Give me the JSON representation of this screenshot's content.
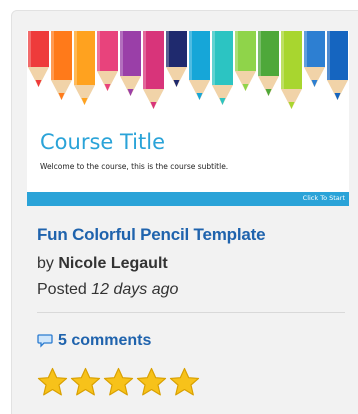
{
  "thumbnail": {
    "course_title": "Course Title",
    "course_subtitle": "Welcome to the course, this is the course subtitle.",
    "start_label": "Click To Start",
    "pencil_colors": [
      "#ee3b3b",
      "#ff7a1a",
      "#ffa21f",
      "#e8437c",
      "#9a3fa8",
      "#d8347a",
      "#1f2a6e",
      "#16a6d8",
      "#2cc4c2",
      "#8fd44a",
      "#4ea83a",
      "#a8d62f",
      "#2d7fd2",
      "#1565c0"
    ]
  },
  "template": {
    "title": "Fun Colorful Pencil Template",
    "by_prefix": "by",
    "author": "Nicole Legault",
    "posted_prefix": "Posted",
    "posted_time": "12 days ago"
  },
  "comments": {
    "icon": "speech-bubble-icon",
    "label": "5 comments"
  },
  "rating": {
    "value": 5,
    "max": 5,
    "star_color": "#f7c21a"
  }
}
